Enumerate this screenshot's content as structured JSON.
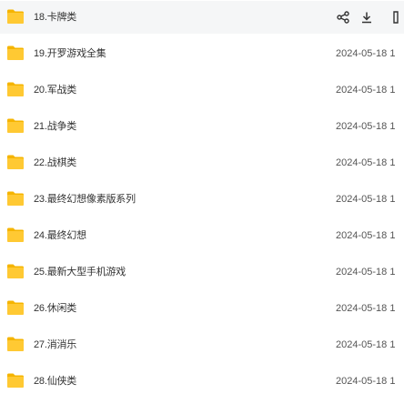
{
  "files": [
    {
      "name": "18.卡牌类",
      "date": "",
      "hover": true
    },
    {
      "name": "19.开罗游戏全集",
      "date": "2024-05-18 1"
    },
    {
      "name": "20.军战类",
      "date": "2024-05-18 1"
    },
    {
      "name": "21.战争类",
      "date": "2024-05-18 1"
    },
    {
      "name": "22.战棋类",
      "date": "2024-05-18 1"
    },
    {
      "name": "23.最终幻想像素版系列",
      "date": "2024-05-18 1"
    },
    {
      "name": "24.最终幻想",
      "date": "2024-05-18 1"
    },
    {
      "name": "25.最新大型手机游戏",
      "date": "2024-05-18 1"
    },
    {
      "name": "26.休闲类",
      "date": "2024-05-18 1"
    },
    {
      "name": "27.消消乐",
      "date": "2024-05-18 1"
    },
    {
      "name": "28.仙侠类",
      "date": "2024-05-18 1"
    }
  ],
  "hover_actions": [
    "share-icon",
    "download-icon",
    "more-icon"
  ],
  "colors": {
    "folder": "#ffc933",
    "folder_tab": "#f5b400",
    "hover_bg": "#f5f6f7",
    "text": "#333333",
    "date": "#555555"
  }
}
